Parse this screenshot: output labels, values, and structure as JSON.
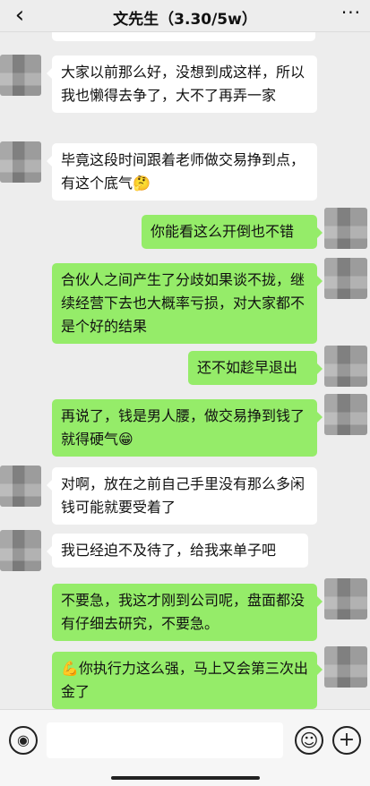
{
  "header": {
    "back_icon": "chevron-left-icon",
    "back_glyph": "‹",
    "title": "文先生（3.30/5w）",
    "more_glyph": "···"
  },
  "messages": [
    {
      "side": "in",
      "text": "大家以前那么好，没想到成这样，所以我也懒得去争了，大不了再弄一家"
    },
    {
      "side": "in",
      "text": "毕竟这段时间跟着老师做交易挣到点，有这个底气",
      "emoji": "🤔"
    },
    {
      "side": "out",
      "text": "你能看这么开倒也不错"
    },
    {
      "side": "out",
      "text": "合伙人之间产生了分歧如果谈不拢，继续经营下去也大概率亏损，对大家都不是个好的结果"
    },
    {
      "side": "out",
      "text": "还不如趁早退出"
    },
    {
      "side": "out",
      "text": "再说了，钱是男人腰，做交易挣到钱了就得硬气",
      "emoji": "😁"
    },
    {
      "side": "in",
      "text": "对啊，放在之前自己手里没有那么多闲钱可能就要受着了"
    },
    {
      "side": "in",
      "text": "我已经迫不及待了，给我来单子吧"
    },
    {
      "side": "out",
      "text": "不要急，我这才刚到公司呢，盘面都没有仔细去研究，不要急。"
    },
    {
      "side": "out",
      "emoji_prefix": "💪",
      "text": "你执行力这么强，马上又会第三次出金了"
    }
  ],
  "input_bar": {
    "voice_icon": "voice-icon",
    "voice_glyph": "◉",
    "emoji_icon": "emoji-icon",
    "emoji_glyph": "☺",
    "plus_icon": "plus-icon",
    "plus_glyph": "+"
  },
  "colors": {
    "incoming": "#ffffff",
    "outgoing": "#95ec69",
    "background": "#ededed"
  }
}
